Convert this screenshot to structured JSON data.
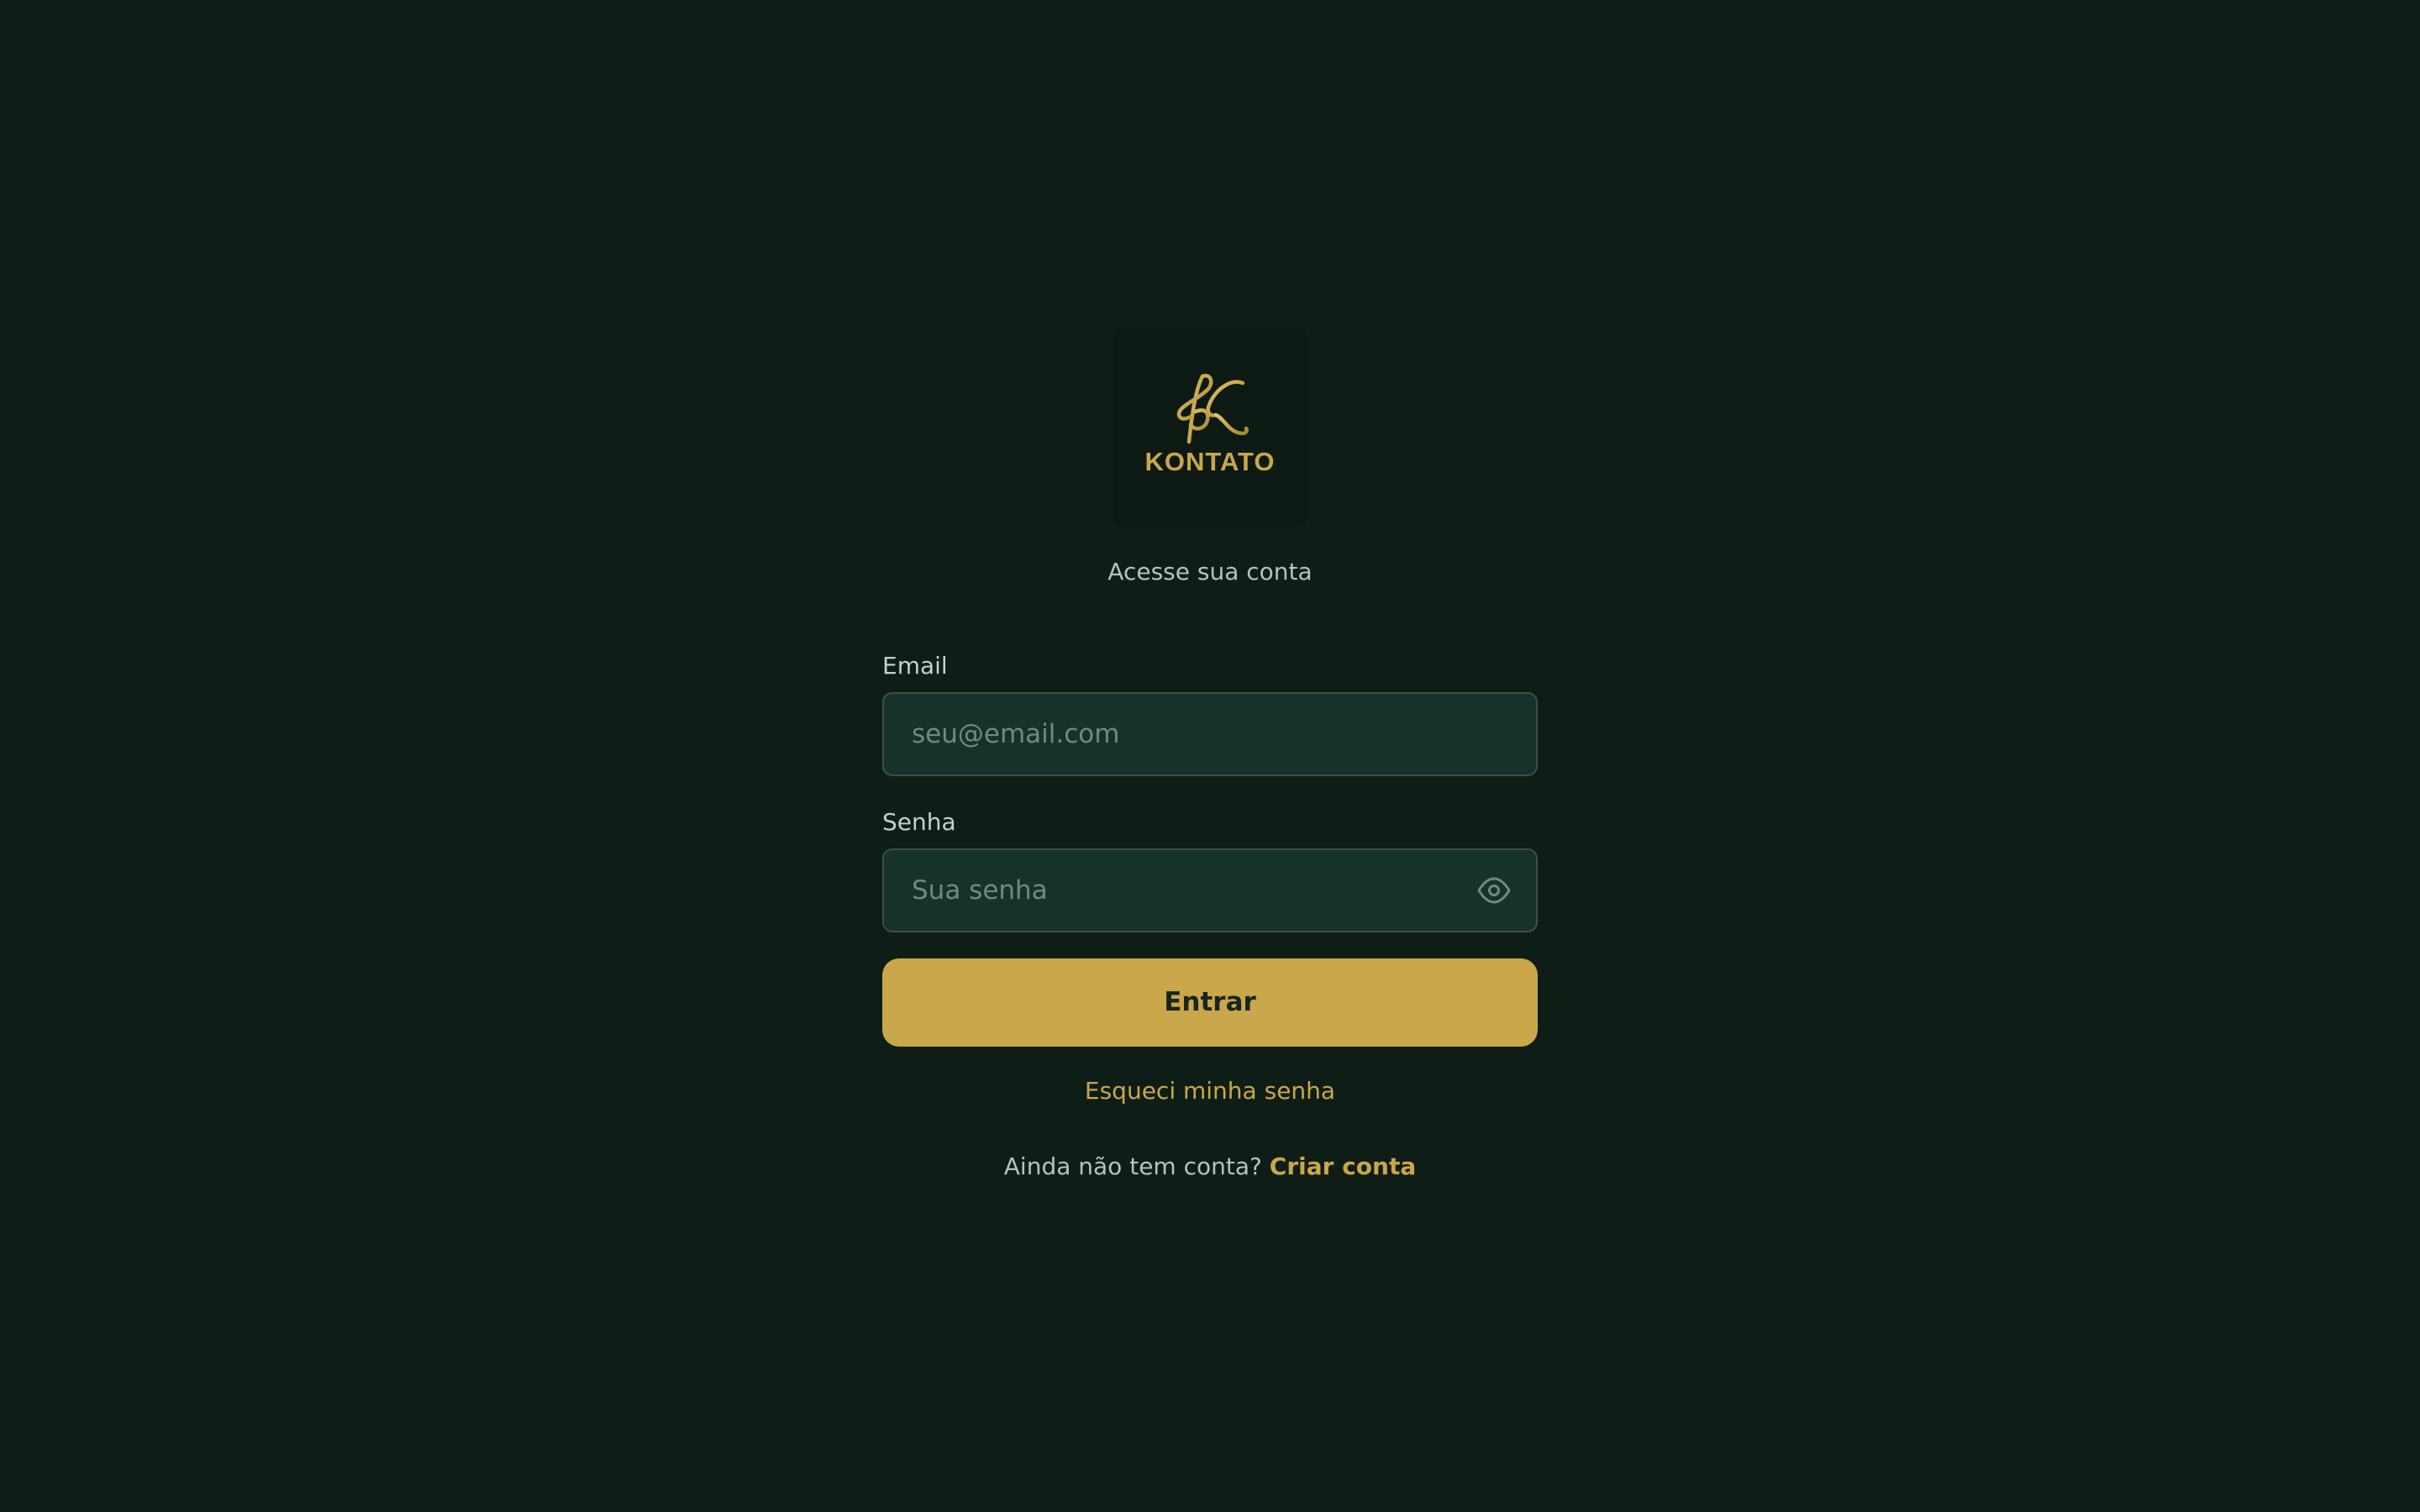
{
  "brand": {
    "name": "KONTATO",
    "logo_icon": "k-monogram-icon",
    "accent": "#c9a74a"
  },
  "colors": {
    "background": "#0f1d17",
    "input_bg": "#17322a",
    "button_text": "#17251f"
  },
  "subtitle": "Acesse sua conta",
  "form": {
    "email_label": "Email",
    "email_placeholder": "seu@email.com",
    "password_label": "Senha",
    "password_placeholder": "Sua senha",
    "password_toggle_icon": "eye-icon",
    "submit_label": "Entrar"
  },
  "links": {
    "forgot_password": "Esqueci minha senha",
    "signup_prompt": "Ainda não tem conta?",
    "signup_link": "Criar conta"
  }
}
